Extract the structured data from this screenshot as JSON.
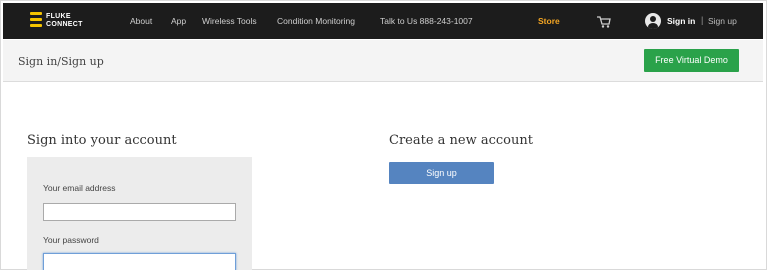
{
  "brand": {
    "logo_text_line1": "FLUKE",
    "logo_text_line2": "CONNECT",
    "accent": "#f5c400"
  },
  "nav": {
    "links": [
      {
        "label": "About"
      },
      {
        "label": "App"
      },
      {
        "label": "Wireless Tools"
      },
      {
        "label": "Condition Monitoring"
      },
      {
        "label": "Talk to Us 888-243-1007"
      }
    ],
    "store_label": "Store",
    "store_color": "#f5a623",
    "cart_icon": "shopping-cart-icon",
    "user_icon": "user-avatar-icon",
    "signin_label": "Sign in",
    "separator": "|",
    "signup_label": "Sign up"
  },
  "subheader": {
    "title": "Sign in/Sign up",
    "demo_button_label": "Free Virtual Demo",
    "demo_button_color": "#2aa24a"
  },
  "signin": {
    "heading": "Sign into your account",
    "email_label": "Your email address",
    "email_value": "",
    "password_label": "Your password",
    "password_value": ""
  },
  "create": {
    "heading": "Create a new account",
    "signup_button_label": "Sign up",
    "signup_button_color": "#5584c0"
  }
}
